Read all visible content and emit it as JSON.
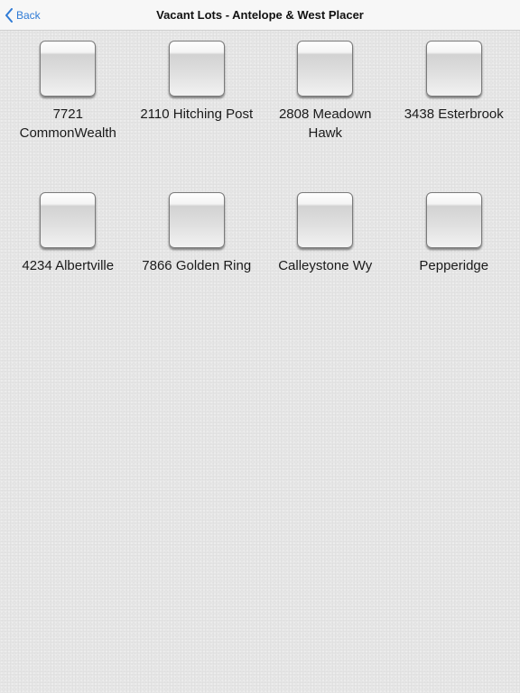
{
  "navbar": {
    "back_label": "Back",
    "title": "Vacant Lots - Antelope & West Placer",
    "accent_color": "#2f7bd6"
  },
  "lots": [
    {
      "label": "7721 CommonWealth"
    },
    {
      "label": "2110 Hitching Post"
    },
    {
      "label": "2808 Meadown Hawk"
    },
    {
      "label": "3438 Esterbrook"
    },
    {
      "label": "4234 Albertville"
    },
    {
      "label": "7866 Golden Ring"
    },
    {
      "label": "Calleystone Wy"
    },
    {
      "label": "Pepperidge"
    }
  ]
}
